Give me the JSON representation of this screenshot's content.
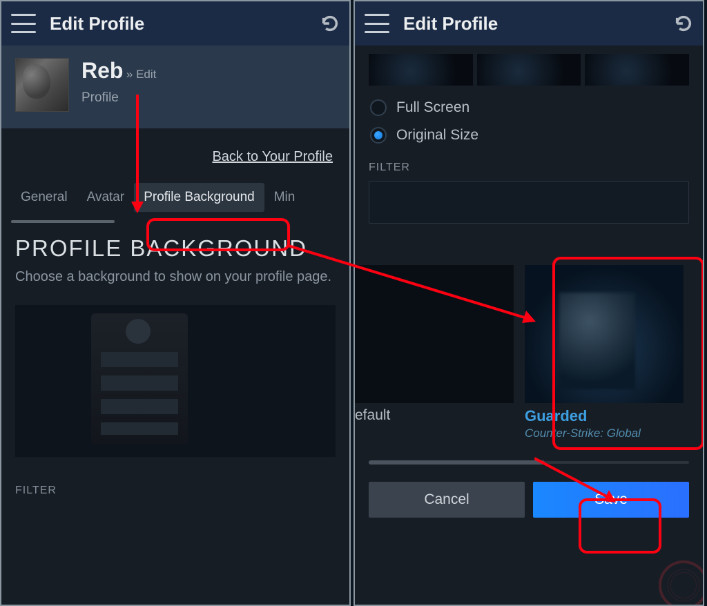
{
  "header": {
    "title": "Edit Profile"
  },
  "profile": {
    "username": "Reb",
    "crumb_prefix": "» Edit",
    "crumb_line2": "Profile"
  },
  "backlink": {
    "label": "Back to Your Profile"
  },
  "tabs": {
    "general": "General",
    "avatar": "Avatar",
    "profile_bg": "Profile Background",
    "min": "Min"
  },
  "section": {
    "title": "PROFILE BACKGROUND",
    "desc": "Choose a background to show on your profile page."
  },
  "filter_label": "FILTER",
  "radio": {
    "fullscreen": "Full Screen",
    "original": "Original Size"
  },
  "cards": {
    "default_label": "efault",
    "guarded": {
      "name": "Guarded",
      "sub": "Counter-Strike: Global"
    }
  },
  "buttons": {
    "cancel": "Cancel",
    "save": "Save"
  }
}
